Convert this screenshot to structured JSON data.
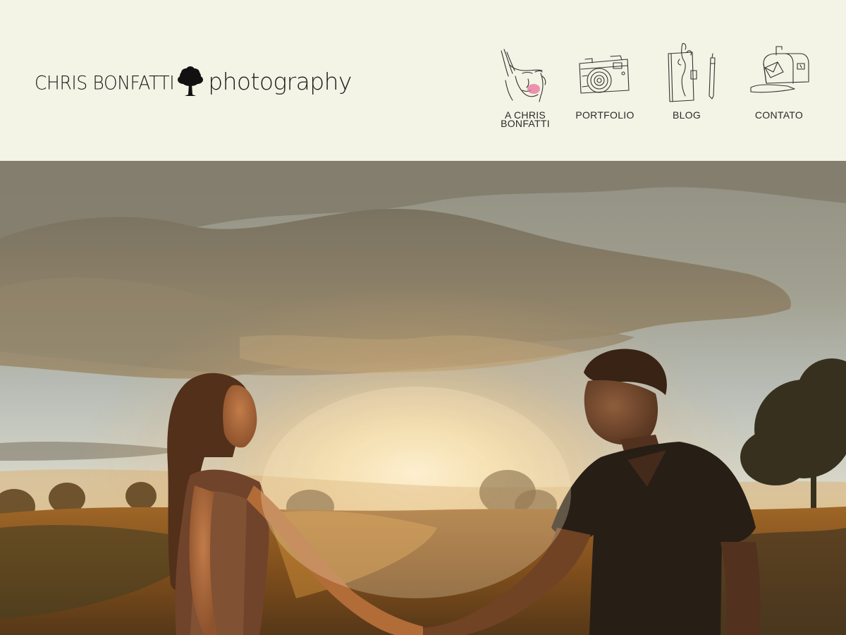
{
  "logo": {
    "name": "CHRIS BONFATTI",
    "sub": "photography"
  },
  "nav": {
    "items": [
      {
        "label": "A CHRIS BONFATTI",
        "icon": "portrait-sketch-icon"
      },
      {
        "label": "PORTFOLIO",
        "icon": "camera-sketch-icon"
      },
      {
        "label": "BLOG",
        "icon": "notebook-pen-sketch-icon"
      },
      {
        "label": "CONTATO",
        "icon": "mailbox-sketch-icon"
      }
    ]
  },
  "hero": {
    "subject": "couple holding hands at sunset"
  },
  "colors": {
    "header_bg": "#f3f4e5",
    "text": "#2a2a2a",
    "accent_pink": "#e8739b"
  }
}
